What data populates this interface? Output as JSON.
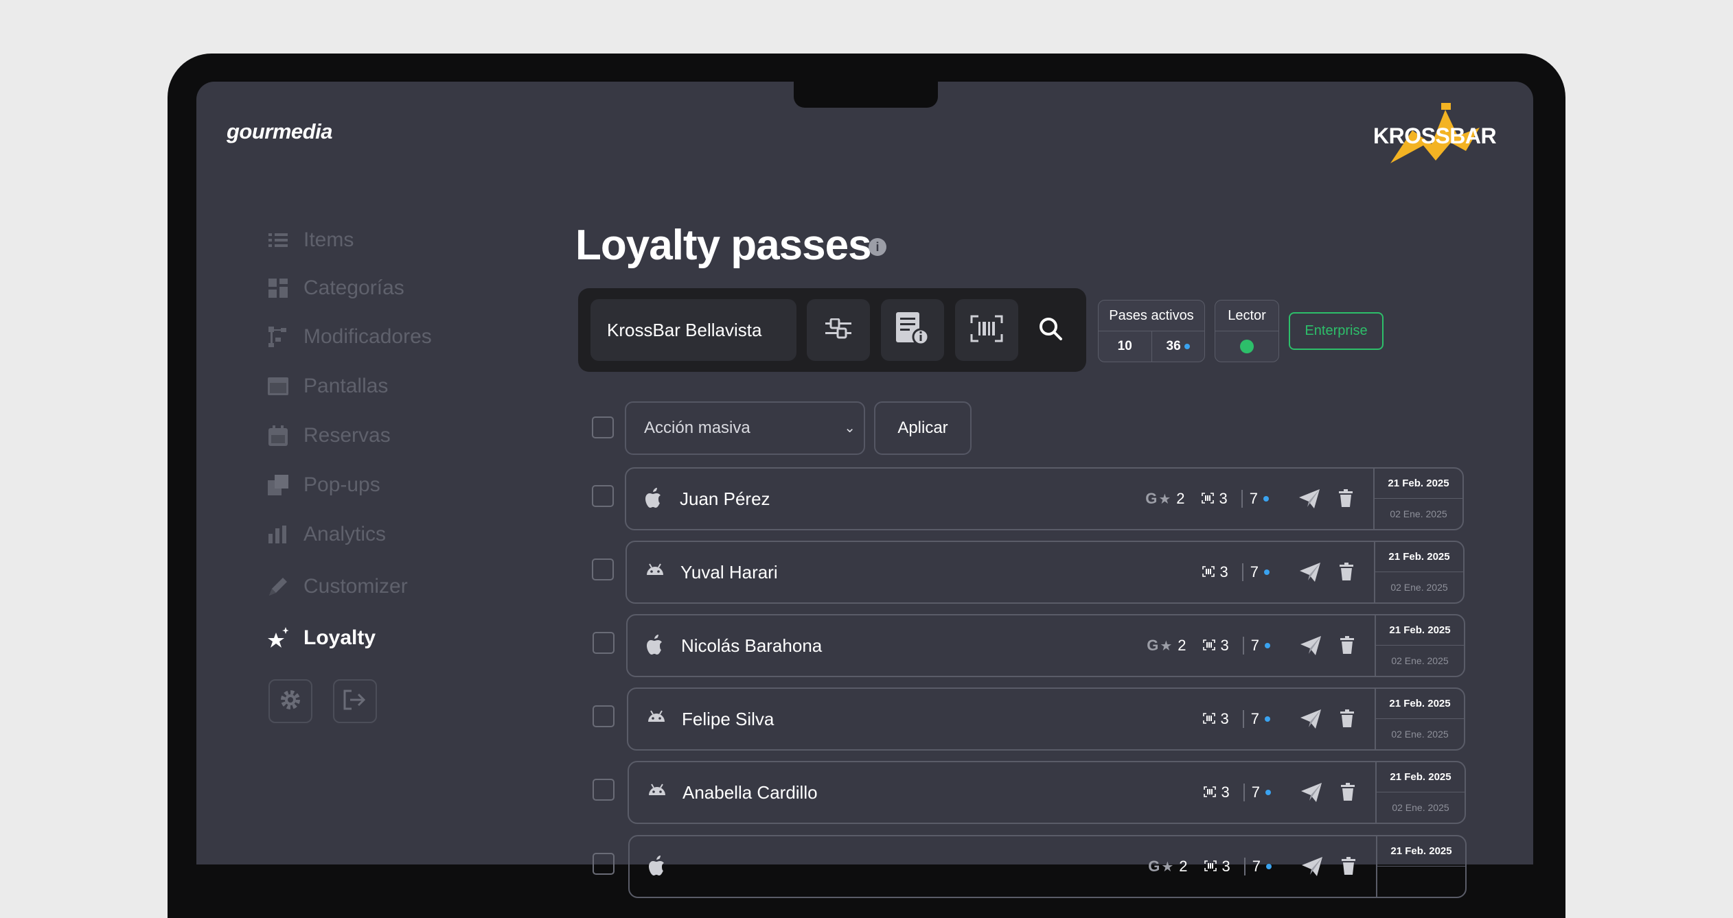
{
  "app": {
    "brand": "gourmedia",
    "client_logo": "KROSSBAR"
  },
  "sidebar": {
    "items": [
      {
        "label": "Items",
        "icon": "list-icon"
      },
      {
        "label": "Categorías",
        "icon": "grid-icon"
      },
      {
        "label": "Modificadores",
        "icon": "hierarchy-icon"
      },
      {
        "label": "Pantallas",
        "icon": "window-icon"
      },
      {
        "label": "Reservas",
        "icon": "calendar-icon"
      },
      {
        "label": "Pop-ups",
        "icon": "layers-icon"
      },
      {
        "label": "Analytics",
        "icon": "bar-chart-icon"
      },
      {
        "label": "Customizer",
        "icon": "pencil-icon"
      },
      {
        "label": "Loyalty",
        "icon": "stars-icon",
        "active": true
      }
    ],
    "footer_buttons": [
      {
        "icon": "gear-icon"
      },
      {
        "icon": "logout-icon"
      }
    ]
  },
  "page": {
    "title": "Loyalty passes"
  },
  "toolbar": {
    "location": "KrossBar Bellavista"
  },
  "stats": {
    "label": "Pases activos",
    "value_a": "10",
    "value_b": "36",
    "reader_label": "Lector",
    "reader_status_color": "#2dbf6a",
    "plan": "Enterprise"
  },
  "bulk": {
    "select_value": "Acción masiva",
    "apply_label": "Aplicar"
  },
  "passes": [
    {
      "name": "Juan Pérez",
      "platform": "apple",
      "google_reviews": "2",
      "scans": "3",
      "visits": "7",
      "date_top": "21 Feb. 2025",
      "date_bottom": "02 Ene. 2025"
    },
    {
      "name": "Yuval Harari",
      "platform": "android",
      "google_reviews": "",
      "scans": "3",
      "visits": "7",
      "date_top": "21 Feb. 2025",
      "date_bottom": "02 Ene. 2025"
    },
    {
      "name": "Nicolás Barahona",
      "platform": "apple",
      "google_reviews": "2",
      "scans": "3",
      "visits": "7",
      "date_top": "21 Feb. 2025",
      "date_bottom": "02 Ene. 2025"
    },
    {
      "name": "Felipe Silva",
      "platform": "android",
      "google_reviews": "",
      "scans": "3",
      "visits": "7",
      "date_top": "21 Feb. 2025",
      "date_bottom": "02 Ene. 2025"
    },
    {
      "name": "Anabella Cardillo",
      "platform": "android",
      "google_reviews": "",
      "scans": "3",
      "visits": "7",
      "date_top": "21 Feb. 2025",
      "date_bottom": "02 Ene. 2025"
    },
    {
      "name": "",
      "platform": "apple",
      "google_reviews": "2",
      "scans": "3",
      "visits": "7",
      "date_top": "21 Feb. 2025",
      "date_bottom": ""
    }
  ],
  "colors": {
    "accent_green": "#2dbf6a",
    "dot_blue": "#3aa3f0",
    "screen_bg": "#383944"
  }
}
